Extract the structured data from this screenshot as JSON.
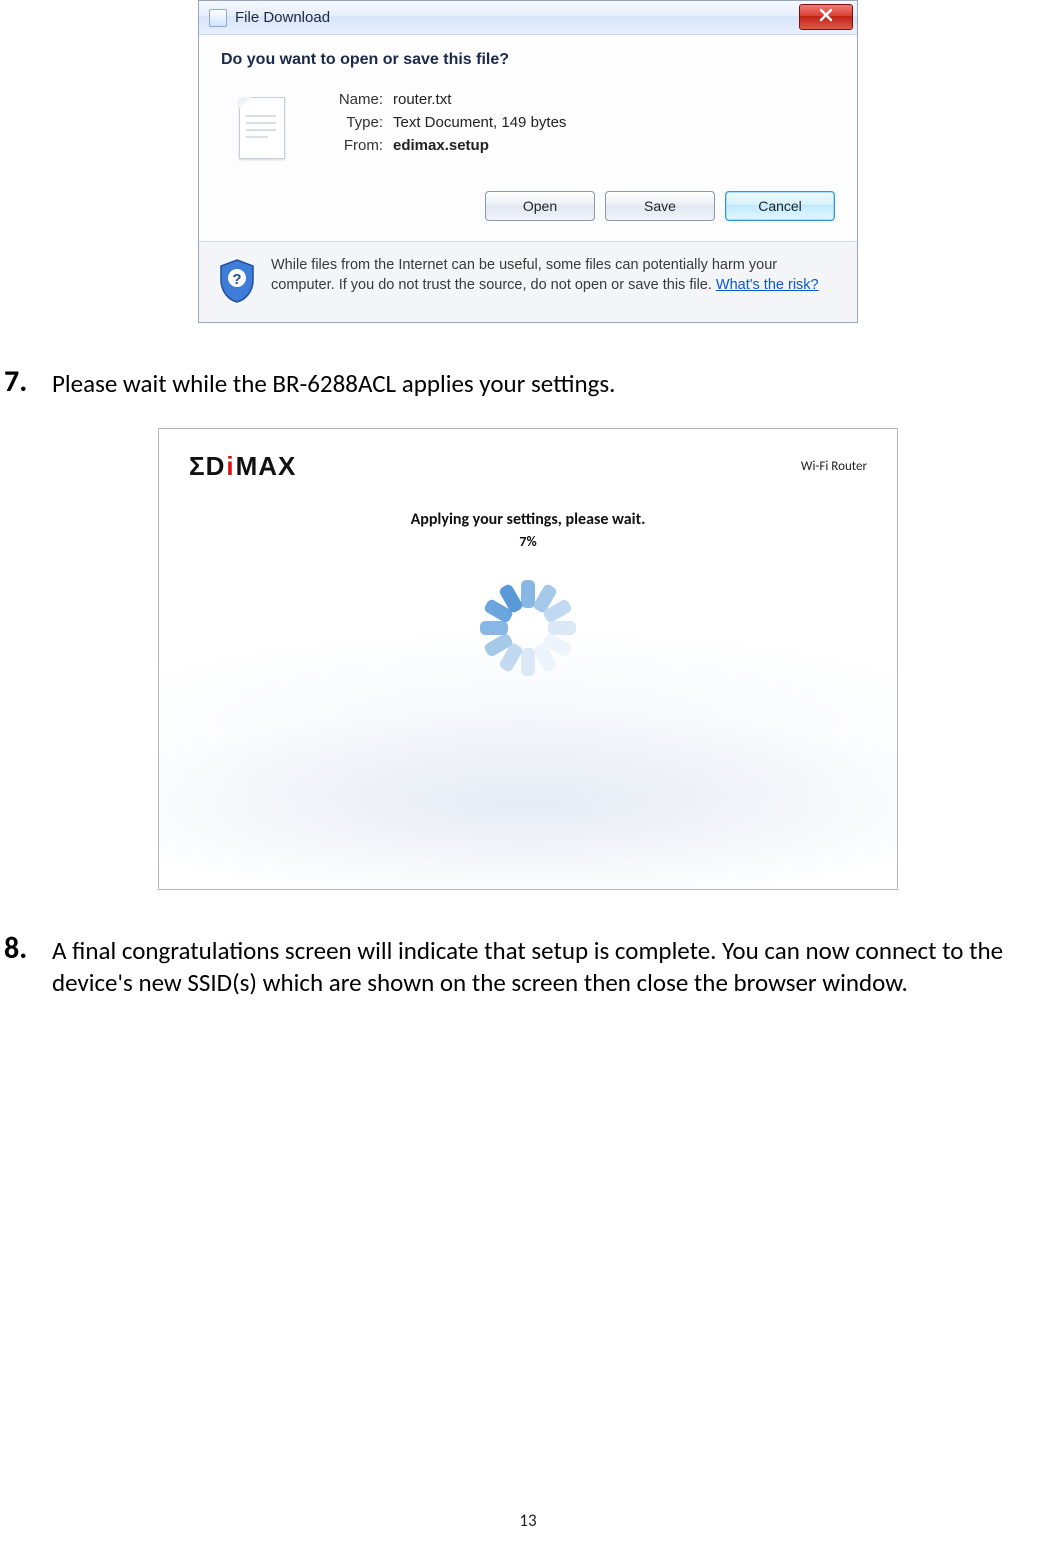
{
  "dialog": {
    "title": "File Download",
    "question": "Do you want to open or save this file?",
    "fields": {
      "name_label": "Name:",
      "name_value": "router.txt",
      "type_label": "Type:",
      "type_value": "Text Document, 149 bytes",
      "from_label": "From:",
      "from_value": "edimax.setup"
    },
    "buttons": {
      "open": "Open",
      "save": "Save",
      "cancel": "Cancel"
    },
    "warning_text": "While files from the Internet can be useful, some files can potentially harm your computer. If you do not trust the source, do not open or save this file. ",
    "warning_link": "What's the risk?"
  },
  "steps": {
    "seven_num": "7.",
    "seven_text": "Please wait while the BR-6288ACL applies your settings.",
    "eight_num": "8.",
    "eight_text": "A final congratulations screen will indicate that setup is complete. You can now connect to the device's new SSID(s) which are shown on the screen then close the browser window."
  },
  "edimax": {
    "logo_text": "EDIMAX",
    "mode": "Wi-Fi Router",
    "status": "Applying your settings, please wait.",
    "percent": "7%"
  },
  "page_number": "13",
  "spinner_colors": [
    "#87b7e4",
    "#a6c9ea",
    "#c2daf1",
    "#dbe9f7",
    "#eef4fb",
    "#eef4fb",
    "#dbe9f7",
    "#c2daf1",
    "#a6c9ea",
    "#87b7e4",
    "#6aa5dd",
    "#5a99d8"
  ]
}
